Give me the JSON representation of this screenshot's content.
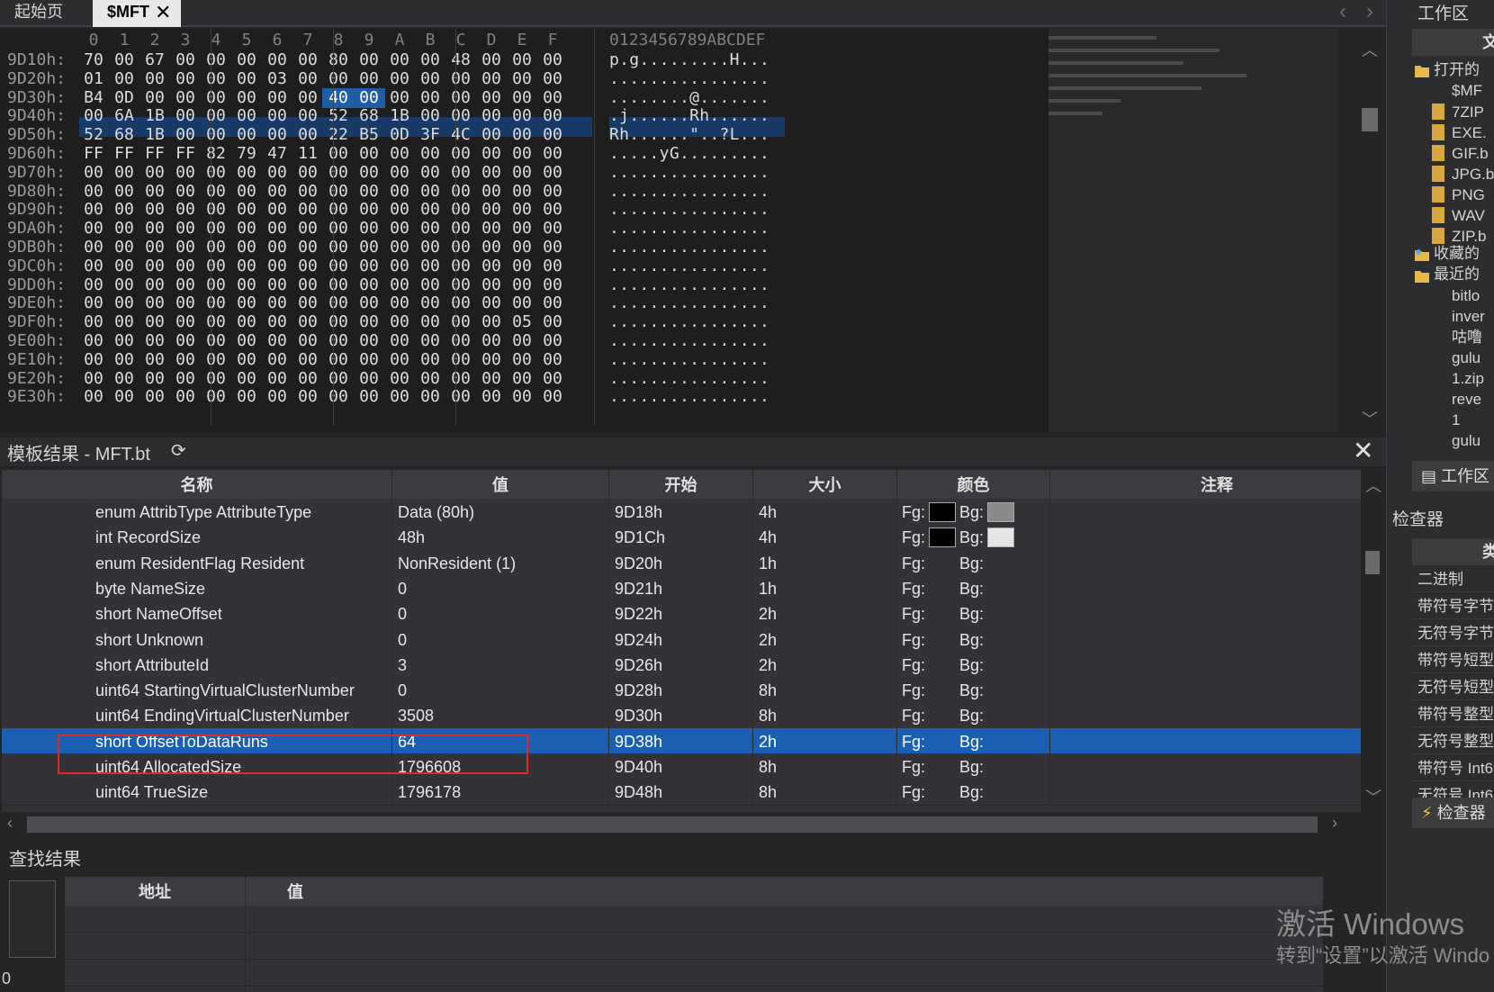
{
  "tabs": {
    "start": "起始页",
    "active": "$MFT",
    "close": "✕"
  },
  "tab_nav": {
    "prev": "‹",
    "next": "›",
    "menu": "⌄"
  },
  "hex": {
    "col_headers": [
      "0",
      "1",
      "2",
      "3",
      "4",
      "5",
      "6",
      "7",
      "8",
      "9",
      "A",
      "B",
      "C",
      "D",
      "E",
      "F"
    ],
    "ascii_header": "0123456789ABCDEF",
    "rows": [
      {
        "addr": "9D10h:",
        "bytes": [
          "70",
          "00",
          "67",
          "00",
          "00",
          "00",
          "00",
          "00",
          "80",
          "00",
          "00",
          "00",
          "48",
          "00",
          "00",
          "00"
        ],
        "ascii": "p.g.........H..."
      },
      {
        "addr": "9D20h:",
        "bytes": [
          "01",
          "00",
          "00",
          "00",
          "00",
          "00",
          "03",
          "00",
          "00",
          "00",
          "00",
          "00",
          "00",
          "00",
          "00",
          "00"
        ],
        "ascii": "................"
      },
      {
        "addr": "9D30h:",
        "bytes": [
          "B4",
          "0D",
          "00",
          "00",
          "00",
          "00",
          "00",
          "00",
          "40",
          "00",
          "00",
          "00",
          "00",
          "00",
          "00",
          "00"
        ],
        "ascii": "........@......."
      },
      {
        "addr": "9D40h:",
        "bytes": [
          "00",
          "6A",
          "1B",
          "00",
          "00",
          "00",
          "00",
          "00",
          "52",
          "68",
          "1B",
          "00",
          "00",
          "00",
          "00",
          "00"
        ],
        "ascii": ".j......Rh......"
      },
      {
        "addr": "9D50h:",
        "bytes": [
          "52",
          "68",
          "1B",
          "00",
          "00",
          "00",
          "00",
          "00",
          "22",
          "B5",
          "0D",
          "3F",
          "4C",
          "00",
          "00",
          "00"
        ],
        "ascii": "Rh......\"..?L..."
      },
      {
        "addr": "9D60h:",
        "bytes": [
          "FF",
          "FF",
          "FF",
          "FF",
          "82",
          "79",
          "47",
          "11",
          "00",
          "00",
          "00",
          "00",
          "00",
          "00",
          "00",
          "00"
        ],
        "ascii": ".....yG........."
      },
      {
        "addr": "9D70h:",
        "bytes": [
          "00",
          "00",
          "00",
          "00",
          "00",
          "00",
          "00",
          "00",
          "00",
          "00",
          "00",
          "00",
          "00",
          "00",
          "00",
          "00"
        ],
        "ascii": "................"
      },
      {
        "addr": "9D80h:",
        "bytes": [
          "00",
          "00",
          "00",
          "00",
          "00",
          "00",
          "00",
          "00",
          "00",
          "00",
          "00",
          "00",
          "00",
          "00",
          "00",
          "00"
        ],
        "ascii": "................"
      },
      {
        "addr": "9D90h:",
        "bytes": [
          "00",
          "00",
          "00",
          "00",
          "00",
          "00",
          "00",
          "00",
          "00",
          "00",
          "00",
          "00",
          "00",
          "00",
          "00",
          "00"
        ],
        "ascii": "................"
      },
      {
        "addr": "9DA0h:",
        "bytes": [
          "00",
          "00",
          "00",
          "00",
          "00",
          "00",
          "00",
          "00",
          "00",
          "00",
          "00",
          "00",
          "00",
          "00",
          "00",
          "00"
        ],
        "ascii": "................"
      },
      {
        "addr": "9DB0h:",
        "bytes": [
          "00",
          "00",
          "00",
          "00",
          "00",
          "00",
          "00",
          "00",
          "00",
          "00",
          "00",
          "00",
          "00",
          "00",
          "00",
          "00"
        ],
        "ascii": "................"
      },
      {
        "addr": "9DC0h:",
        "bytes": [
          "00",
          "00",
          "00",
          "00",
          "00",
          "00",
          "00",
          "00",
          "00",
          "00",
          "00",
          "00",
          "00",
          "00",
          "00",
          "00"
        ],
        "ascii": "................"
      },
      {
        "addr": "9DD0h:",
        "bytes": [
          "00",
          "00",
          "00",
          "00",
          "00",
          "00",
          "00",
          "00",
          "00",
          "00",
          "00",
          "00",
          "00",
          "00",
          "00",
          "00"
        ],
        "ascii": "................"
      },
      {
        "addr": "9DE0h:",
        "bytes": [
          "00",
          "00",
          "00",
          "00",
          "00",
          "00",
          "00",
          "00",
          "00",
          "00",
          "00",
          "00",
          "00",
          "00",
          "00",
          "00"
        ],
        "ascii": "................"
      },
      {
        "addr": "9DF0h:",
        "bytes": [
          "00",
          "00",
          "00",
          "00",
          "00",
          "00",
          "00",
          "00",
          "00",
          "00",
          "00",
          "00",
          "00",
          "00",
          "05",
          "00"
        ],
        "ascii": "................"
      },
      {
        "addr": "9E00h:",
        "bytes": [
          "00",
          "00",
          "00",
          "00",
          "00",
          "00",
          "00",
          "00",
          "00",
          "00",
          "00",
          "00",
          "00",
          "00",
          "00",
          "00"
        ],
        "ascii": "................"
      },
      {
        "addr": "9E10h:",
        "bytes": [
          "00",
          "00",
          "00",
          "00",
          "00",
          "00",
          "00",
          "00",
          "00",
          "00",
          "00",
          "00",
          "00",
          "00",
          "00",
          "00"
        ],
        "ascii": "................"
      },
      {
        "addr": "9E20h:",
        "bytes": [
          "00",
          "00",
          "00",
          "00",
          "00",
          "00",
          "00",
          "00",
          "00",
          "00",
          "00",
          "00",
          "00",
          "00",
          "00",
          "00"
        ],
        "ascii": "................"
      },
      {
        "addr": "9E30h:",
        "bytes": [
          "00",
          "00",
          "00",
          "00",
          "00",
          "00",
          "00",
          "00",
          "00",
          "00",
          "00",
          "00",
          "00",
          "00",
          "00",
          "00"
        ],
        "ascii": "................"
      }
    ]
  },
  "right_panel": {
    "title": "工作区",
    "header": "文",
    "open_files_label": "打开的",
    "mft_item": "$MF",
    "files": [
      "7ZIP",
      "EXE.",
      "GIF.b",
      "JPG.b",
      "PNG",
      "WAV",
      "ZIP.b"
    ],
    "favorites_label": "收藏的",
    "recent_label": "最近的",
    "recent": [
      "bitlo",
      "inver",
      "咕噜",
      "gulu",
      "1.zip",
      "reve",
      "1",
      "gulu"
    ],
    "workspace_tab": "工作区",
    "inspector_label": "检查器",
    "type_header": "类",
    "types": [
      "二进制",
      "带符号字节",
      "无符号字节",
      "带符号短型",
      "无符号短型",
      "带符号整型",
      "无符号整型",
      "带符号 Int6",
      "无符号 Int6"
    ],
    "inspector_tab": "检查器"
  },
  "template": {
    "title": "模板结果 - MFT.bt",
    "refresh_icon": "⟳",
    "close": "✕",
    "columns": [
      "名称",
      "值",
      "开始",
      "大小",
      "颜色",
      "注释"
    ],
    "fg_label": "Fg:",
    "bg_label": "Bg:",
    "rows": [
      {
        "name": "enum AttribType AttributeType",
        "value": "Data (80h)",
        "start": "9D18h",
        "size": "4h",
        "fg": "#000000",
        "bg": "#8a8a8a"
      },
      {
        "name": "int RecordSize",
        "value": "48h",
        "start": "9D1Ch",
        "size": "4h",
        "fg": "#000000",
        "bg": "#e6e6e6"
      },
      {
        "name": "enum ResidentFlag Resident",
        "value": "NonResident (1)",
        "start": "9D20h",
        "size": "1h",
        "fg": "",
        "bg": ""
      },
      {
        "name": "byte NameSize",
        "value": "0",
        "start": "9D21h",
        "size": "1h",
        "fg": "",
        "bg": ""
      },
      {
        "name": "short NameOffset",
        "value": "0",
        "start": "9D22h",
        "size": "2h",
        "fg": "",
        "bg": ""
      },
      {
        "name": "short Unknown",
        "value": "0",
        "start": "9D24h",
        "size": "2h",
        "fg": "",
        "bg": ""
      },
      {
        "name": "short AttributeId",
        "value": "3",
        "start": "9D26h",
        "size": "2h",
        "fg": "",
        "bg": ""
      },
      {
        "name": "uint64 StartingVirtualClusterNumber",
        "value": "0",
        "start": "9D28h",
        "size": "8h",
        "fg": "",
        "bg": ""
      },
      {
        "name": "uint64 EndingVirtualClusterNumber",
        "value": "3508",
        "start": "9D30h",
        "size": "8h",
        "fg": "",
        "bg": ""
      },
      {
        "name": "short OffsetToDataRuns",
        "value": "64",
        "start": "9D38h",
        "size": "2h",
        "fg": "",
        "bg": "",
        "selected": true
      },
      {
        "name": "uint64 AllocatedSize",
        "value": "1796608",
        "start": "9D40h",
        "size": "8h",
        "fg": "",
        "bg": ""
      },
      {
        "name": "uint64 TrueSize",
        "value": "1796178",
        "start": "9D48h",
        "size": "8h",
        "fg": "",
        "bg": ""
      }
    ]
  },
  "find": {
    "title": "查找结果",
    "columns": [
      "地址",
      "值"
    ],
    "count": "0"
  },
  "watermark": {
    "line1": "激活 Windows",
    "line2": "转到“设置”以激活 Windo"
  },
  "colors": {
    "selection": "#1a5fb4",
    "highlight_box": "#e0282a"
  }
}
